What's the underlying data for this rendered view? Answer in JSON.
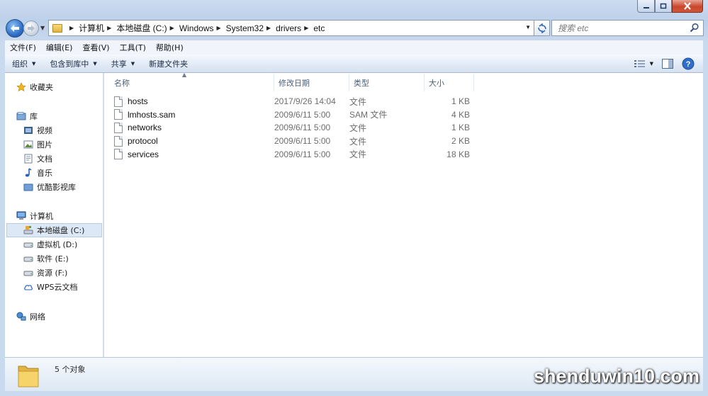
{
  "window": {
    "controls": [
      "minimize",
      "maximize",
      "close"
    ]
  },
  "address_bar": {
    "breadcrumbs": [
      "计算机",
      "本地磁盘 (C:)",
      "Windows",
      "System32",
      "drivers",
      "etc"
    ],
    "search_placeholder": "搜索 etc"
  },
  "menu": {
    "items": [
      "文件(F)",
      "编辑(E)",
      "查看(V)",
      "工具(T)",
      "帮助(H)"
    ]
  },
  "toolbar": {
    "organize": "组织",
    "include_in_library": "包含到库中",
    "share": "共享",
    "new_folder": "新建文件夹"
  },
  "sidebar": {
    "favorites": "收藏夹",
    "libraries": "库",
    "library_items": [
      "视频",
      "图片",
      "文档",
      "音乐",
      "优酷影视库"
    ],
    "computer": "计算机",
    "drives": [
      "本地磁盘 (C:)",
      "虚拟机 (D:)",
      "软件 (E:)",
      "资源 (F:)",
      "WPS云文档"
    ],
    "network": "网络"
  },
  "columns": {
    "name": "名称",
    "date": "修改日期",
    "type": "类型",
    "size": "大小"
  },
  "files": [
    {
      "name": "hosts",
      "date": "2017/9/26 14:04",
      "type": "文件",
      "size": "1 KB"
    },
    {
      "name": "lmhosts.sam",
      "date": "2009/6/11 5:00",
      "type": "SAM 文件",
      "size": "4 KB"
    },
    {
      "name": "networks",
      "date": "2009/6/11 5:00",
      "type": "文件",
      "size": "1 KB"
    },
    {
      "name": "protocol",
      "date": "2009/6/11 5:00",
      "type": "文件",
      "size": "2 KB"
    },
    {
      "name": "services",
      "date": "2009/6/11 5:00",
      "type": "文件",
      "size": "18 KB"
    }
  ],
  "status": {
    "item_count": "5 个对象"
  },
  "watermark": "shenduwin10.com"
}
